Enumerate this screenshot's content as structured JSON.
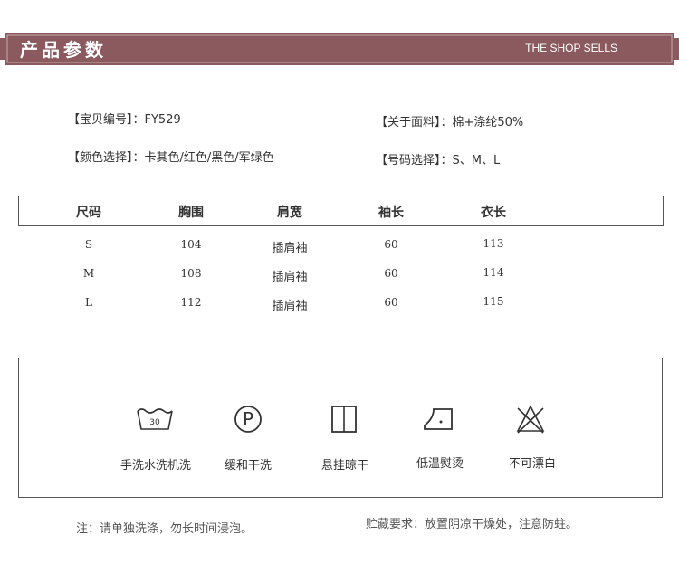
{
  "header": {
    "title": "产品参数",
    "subtitle": "THE SHOP SELLS",
    "color": "#8a5a5e"
  },
  "info": {
    "item_no": "【宝贝编号】：FY529",
    "fabric": "【关于面料】：棉+涤纶50%",
    "colors": "【颜色选择】：卡其色/红色/黑色/军绿色",
    "sizes": "【号码选择】：S、M、L"
  },
  "table": {
    "headers": [
      "尺码",
      "胸围",
      "肩宽",
      "袖长",
      "衣长"
    ],
    "rows": [
      [
        "S",
        "104",
        "插肩袖",
        "60",
        "113"
      ],
      [
        "M",
        "108",
        "插肩袖",
        "60",
        "114"
      ],
      [
        "L",
        "112",
        "插肩袖",
        "60",
        "115"
      ]
    ]
  },
  "care": [
    {
      "icon": "hand-wash-30-icon",
      "label": "手洗水洗机洗",
      "temp": "30"
    },
    {
      "icon": "dry-clean-p-icon",
      "label": "缓和干洗",
      "mark": "P"
    },
    {
      "icon": "line-dry-icon",
      "label": "悬挂晾干"
    },
    {
      "icon": "low-iron-icon",
      "label": "低温熨烫"
    },
    {
      "icon": "no-bleach-icon",
      "label": "不可漂白"
    }
  ],
  "notes": {
    "left": "注：请单独洗涤，勿长时间浸泡。",
    "right": "贮藏要求：放置阴凉干燥处，注意防蛀。"
  }
}
